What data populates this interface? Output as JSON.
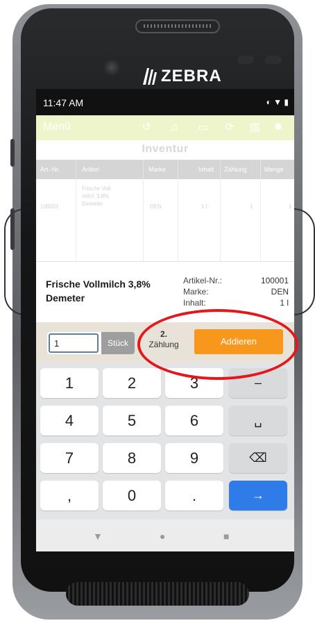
{
  "device": {
    "brand": "ZEBRA",
    "colors": {
      "accent": "#f7981d",
      "enter_key": "#2f7ce9",
      "annotation": "#e4171b",
      "app_bar": "#eef5cb"
    }
  },
  "status_bar": {
    "time": "11:47 AM",
    "icons": [
      "sync-icon",
      "wifi-icon",
      "battery-icon"
    ]
  },
  "app_bar": {
    "menu_label": "Menü",
    "icons": [
      "history-icon",
      "bell-icon",
      "inbox-icon",
      "refresh-icon",
      "trash-icon",
      "settings-icon"
    ]
  },
  "page": {
    "title": "Inventur"
  },
  "table": {
    "columns": [
      "Art.-Nr.",
      "Artikel",
      "Marke",
      "Inhalt",
      "Zählung",
      "Menge"
    ],
    "rows": [
      {
        "art_nr": "100001",
        "artikel": "Frische Voll milch 3,8% Demeter",
        "marke": "DEN",
        "inhalt": "1 l",
        "zaehlung": "1",
        "menge": "1"
      }
    ]
  },
  "product": {
    "name": "Frische Vollmilch 3,8% Demeter",
    "labels": {
      "art_nr": "Artikel-Nr.:",
      "marke": "Marke:",
      "inhalt": "Inhalt:"
    },
    "values": {
      "art_nr": "100001",
      "marke": "DEN",
      "inhalt": "1 l"
    }
  },
  "input": {
    "quantity": "1",
    "unit": "Stück",
    "count_number": "2.",
    "count_label": "Zählung",
    "add_button": "Addieren"
  },
  "keypad": {
    "keys": [
      "1",
      "2",
      "3",
      "–",
      "4",
      "5",
      "6",
      "␣",
      "7",
      "8",
      "9",
      "⌫",
      ",",
      "0",
      ".",
      "→"
    ]
  }
}
